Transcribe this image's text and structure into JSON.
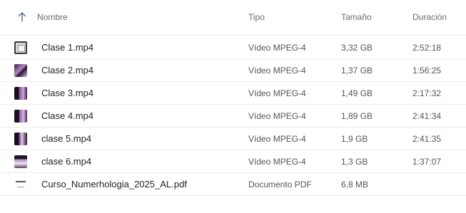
{
  "header": {
    "name_label": "Nombre",
    "type_label": "Tipo",
    "size_label": "Tamaño",
    "duration_label": "Duración"
  },
  "files": [
    {
      "name": "Clase 1.mp4",
      "type": "Vídeo MPEG-4",
      "size": "3,32 GB",
      "duration": "2:52:18",
      "icon": "video-thumbnail"
    },
    {
      "name": "Clase 2.mp4",
      "type": "Vídeo MPEG-4",
      "size": "1,37 GB",
      "duration": "1:56:25",
      "icon": "video-thumbnail"
    },
    {
      "name": "Clase 3.mp4",
      "type": "Vídeo MPEG-4",
      "size": "1,49 GB",
      "duration": "2:17:32",
      "icon": "video-thumbnail"
    },
    {
      "name": "Clase 4.mp4",
      "type": "Vídeo MPEG-4",
      "size": "1,89 GB",
      "duration": "2:41:34",
      "icon": "video-thumbnail"
    },
    {
      "name": "clase 5.mp4",
      "type": "Vídeo MPEG-4",
      "size": "1,9 GB",
      "duration": "2:41:35",
      "icon": "video-thumbnail"
    },
    {
      "name": "clase 6.mp4",
      "type": "Vídeo MPEG-4",
      "size": "1,3 GB",
      "duration": "1:37:07",
      "icon": "video-thumbnail"
    },
    {
      "name": "Curso_Numerhologia_2025_AL.pdf",
      "type": "Documento PDF",
      "size": "6,8 MB",
      "duration": "",
      "icon": "pdf-thumbnail"
    }
  ]
}
